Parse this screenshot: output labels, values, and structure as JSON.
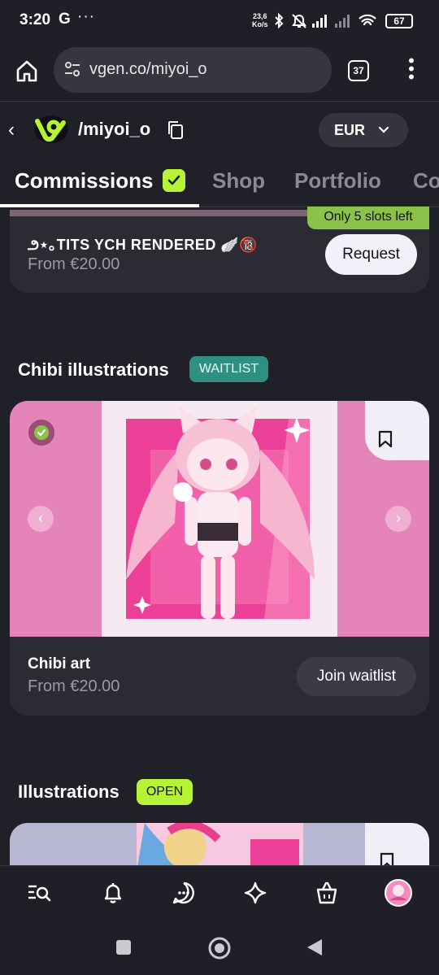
{
  "status_bar": {
    "time": "3:20",
    "carrier_icon": "G",
    "more": "···",
    "net_speed_value": "23,6",
    "net_speed_unit": "Ko/s",
    "battery": "67",
    "icons": [
      "bluetooth-icon",
      "mute-icon",
      "signal-icon",
      "signal-icon",
      "wifi-icon",
      "battery-icon"
    ]
  },
  "browser": {
    "url": "vgen.co/miyoi_o",
    "tab_count": "37"
  },
  "header": {
    "username": "/miyoi_o",
    "currency": "EUR"
  },
  "tabs": [
    {
      "label": "Commissions",
      "active": true
    },
    {
      "label": "Shop"
    },
    {
      "label": "Portfolio"
    },
    {
      "label": "Co"
    }
  ],
  "card1": {
    "slots_badge": "Only 5 slots left",
    "title": "౨⋆｡TITS YCH RENDERED 🪽🔞",
    "price": "From €20.00",
    "button": "Request"
  },
  "section_chibi": {
    "title": "Chibi illustrations",
    "badge": "WAITLIST"
  },
  "card2": {
    "title": "Chibi art",
    "price": "From €20.00",
    "button": "Join waitlist"
  },
  "section_illustrations": {
    "title": "Illustrations",
    "badge": "OPEN"
  },
  "colors": {
    "background": "#202029",
    "card": "#2b2b34",
    "accent_green": "#b6f235",
    "waitlist_teal": "#2f8f82",
    "slots_green": "#8bc34a",
    "pink": "#e584b9"
  }
}
